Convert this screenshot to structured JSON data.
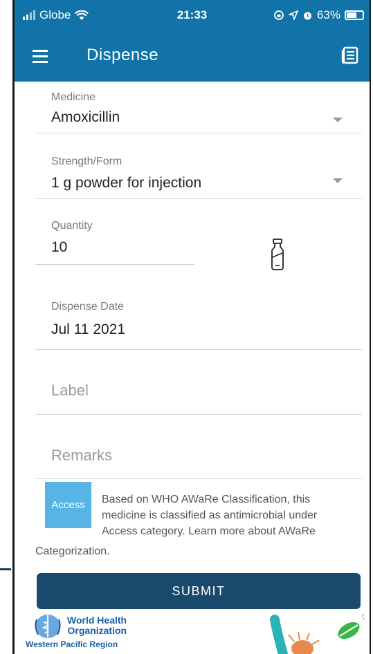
{
  "status_bar": {
    "carrier": "Globe",
    "time": "21:33",
    "battery_percent": "63%",
    "battery_level": 0.63
  },
  "app_bar": {
    "title": "Dispense",
    "menu_icon": "hamburger-menu-icon",
    "action_icon": "newspaper-icon"
  },
  "form": {
    "medicine": {
      "label": "Medicine",
      "value": "Amoxicillin"
    },
    "strength": {
      "label": "Strength/Form",
      "value": "1 g powder for injection"
    },
    "quantity": {
      "label": "Quantity",
      "value": "10",
      "unit_icon": "vial-icon"
    },
    "dispense_date": {
      "label": "Dispense Date",
      "value": "Jul 11 2021"
    },
    "label_field": {
      "placeholder": "Label"
    },
    "remarks_field": {
      "placeholder": "Remarks"
    }
  },
  "aware": {
    "badge": "Access",
    "badge_color": "#57b4e7",
    "text_line1": "Based on WHO AWaRe Classification, this",
    "text_line2": "medicine is classified as antimicrobial under",
    "text_line3": "Access category. Learn more about AWaRe",
    "text_line4": "Categorization."
  },
  "submit_label": "SUBMIT",
  "footer": {
    "org_line1": "World Health",
    "org_line2": "Organization",
    "org_sub": "Western Pacific Region"
  },
  "colors": {
    "primary": "#1273a8",
    "submit": "#1a4a6b"
  }
}
